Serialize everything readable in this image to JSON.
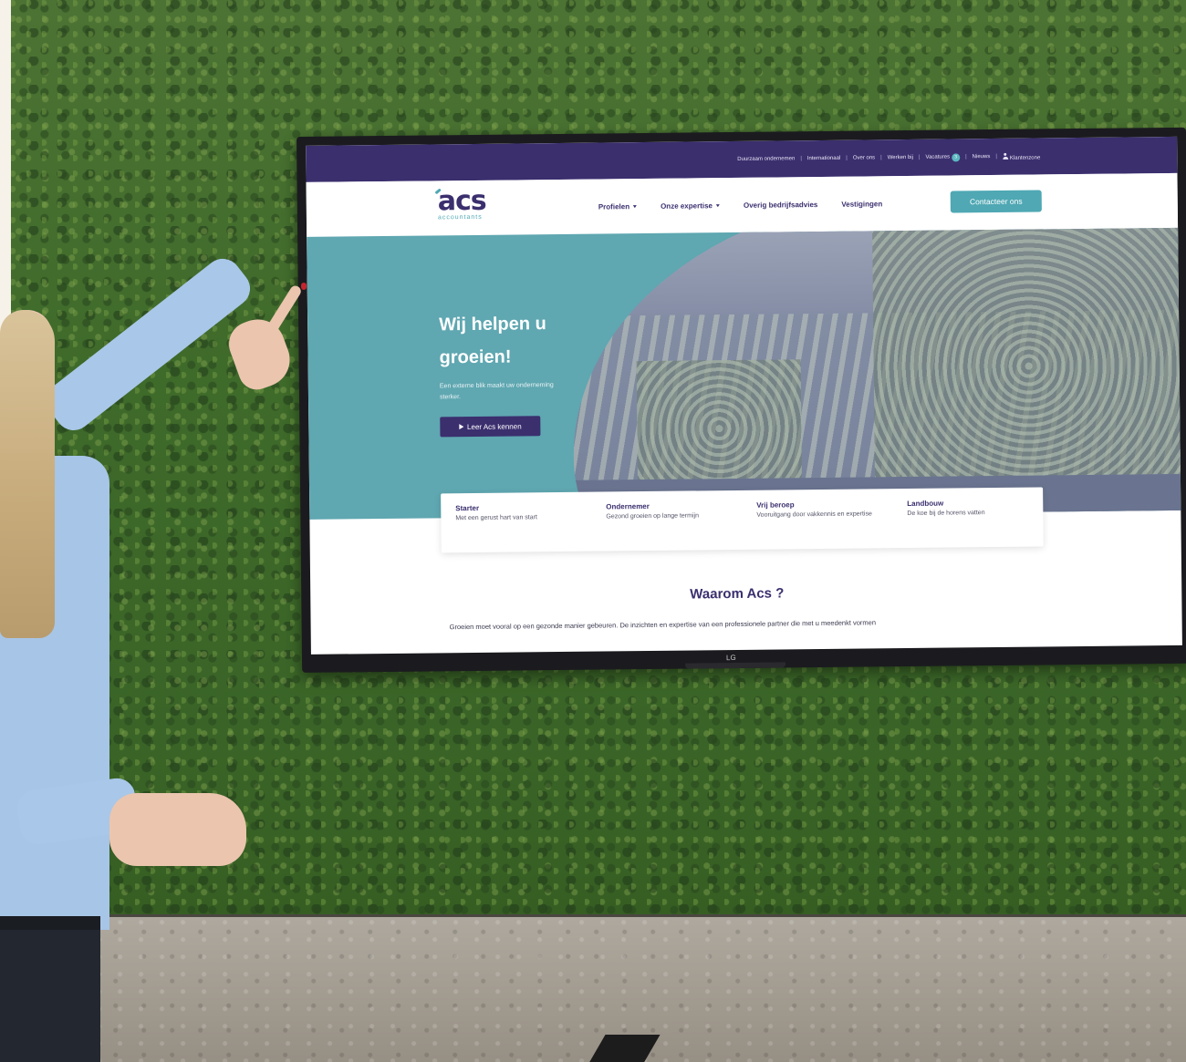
{
  "topbar": {
    "links": [
      "Duurzaam ondernemen",
      "Internationaal",
      "Over ons",
      "Werken bij",
      "Vacatures",
      "Nieuws",
      "Klantenzone"
    ],
    "vacatures_badge": "3",
    "separator": "|"
  },
  "logo": {
    "mark": "acs",
    "sub": "accountants"
  },
  "nav": {
    "items": [
      "Profielen",
      "Onze expertise",
      "Overig bedrijfsadvies",
      "Vestigingen"
    ],
    "cta": "Contacteer ons"
  },
  "hero": {
    "title": "Wij helpen u groeien!",
    "subtitle": "Een externe blik maakt uw onderneming sterker.",
    "button": "Leer Acs kennen"
  },
  "cards": [
    {
      "title": "Starter",
      "text": "Met een gerust hart van start"
    },
    {
      "title": "Ondernemer",
      "text": "Gezond groeien op lange termijn"
    },
    {
      "title": "Vrij beroep",
      "text": "Vooruitgang door vakkennis en expertise"
    },
    {
      "title": "Landbouw",
      "text": "De koe bij de horens vatten"
    }
  ],
  "why": {
    "title": "Waarom Acs ?",
    "text": "Groeien moet vooral op een gezonde manier gebeuren. De inzichten en expertise van een professionele partner die met u meedenkt vormen"
  },
  "tv": {
    "brand": "LG"
  },
  "colors": {
    "primary": "#3b2f6e",
    "accent": "#4fa8b4",
    "moss": "#3e6a2a"
  }
}
